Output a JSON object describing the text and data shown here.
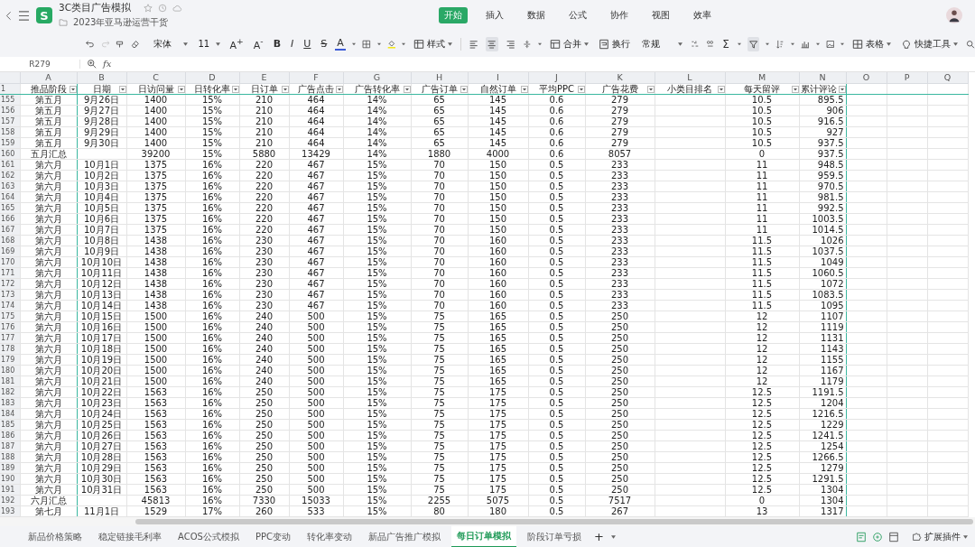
{
  "app": {
    "logo": "S",
    "title": "3C类目广告模拟",
    "location": "2023年亚马逊运营干货"
  },
  "menu_tabs": [
    {
      "label": "开始",
      "selected": true
    },
    {
      "label": "插入",
      "selected": false
    },
    {
      "label": "数据",
      "selected": false
    },
    {
      "label": "公式",
      "selected": false
    },
    {
      "label": "协作",
      "selected": false
    },
    {
      "label": "视图",
      "selected": false
    },
    {
      "label": "效率",
      "selected": false
    }
  ],
  "toolbar": {
    "redo_disabled": true,
    "font": "宋体",
    "font_size": "11",
    "grow_font": "A$^{+}$",
    "shrink_font": "A$^{-}$",
    "bold": "B",
    "italic": "I",
    "underline": "U",
    "strike": "S",
    "font_color": "A",
    "style": "样式",
    "align_buttons": [
      {
        "selected": false
      },
      {
        "selected": true
      },
      {
        "selected": false
      }
    ],
    "merge": "合并",
    "wrap": "换行",
    "number_format": "常规",
    "sum": "Σ",
    "filter_active": true,
    "table": "表格",
    "quick_tools": "快捷工具"
  },
  "formula_bar": {
    "cell": "R279",
    "fx": "fx"
  },
  "sheet": {
    "columns": [
      "A",
      "B",
      "C",
      "D",
      "E",
      "F",
      "G",
      "H",
      "I",
      "J",
      "K",
      "L",
      "M",
      "N",
      "O",
      "P",
      "Q"
    ],
    "header_row": "1",
    "headers": [
      "推品阶段",
      "日期",
      "日访问量",
      "日转化率",
      "日订单",
      "广告点击",
      "广告转化率",
      "广告订单",
      "自然订单",
      "平均PPC",
      "广告花费",
      "小类目排名",
      "每天留评",
      "累计评论"
    ],
    "rows": [
      {
        "n": "155",
        "cells": [
          "第五月",
          "9月26日",
          "1400",
          "15%",
          "210",
          "464",
          "14%",
          "65",
          "145",
          "0.6",
          "279",
          null,
          "10.5",
          "895.5"
        ]
      },
      {
        "n": "156",
        "cells": [
          "第五月",
          "9月27日",
          "1400",
          "15%",
          "210",
          "464",
          "14%",
          "65",
          "145",
          "0.6",
          "279",
          null,
          "10.5",
          "906"
        ]
      },
      {
        "n": "157",
        "cells": [
          "第五月",
          "9月28日",
          "1400",
          "15%",
          "210",
          "464",
          "14%",
          "65",
          "145",
          "0.6",
          "279",
          null,
          "10.5",
          "916.5"
        ]
      },
      {
        "n": "158",
        "cells": [
          "第五月",
          "9月29日",
          "1400",
          "15%",
          "210",
          "464",
          "14%",
          "65",
          "145",
          "0.6",
          "279",
          null,
          "10.5",
          "927"
        ]
      },
      {
        "n": "159",
        "cells": [
          "第五月",
          "9月30日",
          "1400",
          "15%",
          "210",
          "464",
          "14%",
          "65",
          "145",
          "0.6",
          "279",
          null,
          "10.5",
          "937.5"
        ]
      },
      {
        "n": "160",
        "cells": [
          "五月汇总",
          null,
          "39200",
          "15%",
          "5880",
          "13429",
          "14%",
          "1880",
          "4000",
          "0.6",
          "8057",
          null,
          "0",
          "937.5"
        ]
      },
      {
        "n": "161",
        "cells": [
          "第六月",
          "10月1日",
          "1375",
          "16%",
          "220",
          "467",
          "15%",
          "70",
          "150",
          "0.5",
          "233",
          null,
          "11",
          "948.5"
        ]
      },
      {
        "n": "162",
        "cells": [
          "第六月",
          "10月2日",
          "1375",
          "16%",
          "220",
          "467",
          "15%",
          "70",
          "150",
          "0.5",
          "233",
          null,
          "11",
          "959.5"
        ]
      },
      {
        "n": "163",
        "cells": [
          "第六月",
          "10月3日",
          "1375",
          "16%",
          "220",
          "467",
          "15%",
          "70",
          "150",
          "0.5",
          "233",
          null,
          "11",
          "970.5"
        ]
      },
      {
        "n": "164",
        "cells": [
          "第六月",
          "10月4日",
          "1375",
          "16%",
          "220",
          "467",
          "15%",
          "70",
          "150",
          "0.5",
          "233",
          null,
          "11",
          "981.5"
        ]
      },
      {
        "n": "165",
        "cells": [
          "第六月",
          "10月5日",
          "1375",
          "16%",
          "220",
          "467",
          "15%",
          "70",
          "150",
          "0.5",
          "233",
          null,
          "11",
          "992.5"
        ]
      },
      {
        "n": "166",
        "cells": [
          "第六月",
          "10月6日",
          "1375",
          "16%",
          "220",
          "467",
          "15%",
          "70",
          "150",
          "0.5",
          "233",
          null,
          "11",
          "1003.5"
        ]
      },
      {
        "n": "167",
        "cells": [
          "第六月",
          "10月7日",
          "1375",
          "16%",
          "220",
          "467",
          "15%",
          "70",
          "150",
          "0.5",
          "233",
          null,
          "11",
          "1014.5"
        ]
      },
      {
        "n": "168",
        "cells": [
          "第六月",
          "10月8日",
          "1438",
          "16%",
          "230",
          "467",
          "15%",
          "70",
          "160",
          "0.5",
          "233",
          null,
          "11.5",
          "1026"
        ]
      },
      {
        "n": "169",
        "cells": [
          "第六月",
          "10月9日",
          "1438",
          "16%",
          "230",
          "467",
          "15%",
          "70",
          "160",
          "0.5",
          "233",
          null,
          "11.5",
          "1037.5"
        ]
      },
      {
        "n": "170",
        "cells": [
          "第六月",
          "10月10日",
          "1438",
          "16%",
          "230",
          "467",
          "15%",
          "70",
          "160",
          "0.5",
          "233",
          null,
          "11.5",
          "1049"
        ]
      },
      {
        "n": "171",
        "cells": [
          "第六月",
          "10月11日",
          "1438",
          "16%",
          "230",
          "467",
          "15%",
          "70",
          "160",
          "0.5",
          "233",
          null,
          "11.5",
          "1060.5"
        ]
      },
      {
        "n": "172",
        "cells": [
          "第六月",
          "10月12日",
          "1438",
          "16%",
          "230",
          "467",
          "15%",
          "70",
          "160",
          "0.5",
          "233",
          null,
          "11.5",
          "1072"
        ]
      },
      {
        "n": "173",
        "cells": [
          "第六月",
          "10月13日",
          "1438",
          "16%",
          "230",
          "467",
          "15%",
          "70",
          "160",
          "0.5",
          "233",
          null,
          "11.5",
          "1083.5"
        ]
      },
      {
        "n": "174",
        "cells": [
          "第六月",
          "10月14日",
          "1438",
          "16%",
          "230",
          "467",
          "15%",
          "70",
          "160",
          "0.5",
          "233",
          null,
          "11.5",
          "1095"
        ]
      },
      {
        "n": "175",
        "cells": [
          "第六月",
          "10月15日",
          "1500",
          "16%",
          "240",
          "500",
          "15%",
          "75",
          "165",
          "0.5",
          "250",
          null,
          "12",
          "1107"
        ]
      },
      {
        "n": "176",
        "cells": [
          "第六月",
          "10月16日",
          "1500",
          "16%",
          "240",
          "500",
          "15%",
          "75",
          "165",
          "0.5",
          "250",
          null,
          "12",
          "1119"
        ]
      },
      {
        "n": "177",
        "cells": [
          "第六月",
          "10月17日",
          "1500",
          "16%",
          "240",
          "500",
          "15%",
          "75",
          "165",
          "0.5",
          "250",
          null,
          "12",
          "1131"
        ]
      },
      {
        "n": "178",
        "cells": [
          "第六月",
          "10月18日",
          "1500",
          "16%",
          "240",
          "500",
          "15%",
          "75",
          "165",
          "0.5",
          "250",
          null,
          "12",
          "1143"
        ]
      },
      {
        "n": "179",
        "cells": [
          "第六月",
          "10月19日",
          "1500",
          "16%",
          "240",
          "500",
          "15%",
          "75",
          "165",
          "0.5",
          "250",
          null,
          "12",
          "1155"
        ]
      },
      {
        "n": "180",
        "cells": [
          "第六月",
          "10月20日",
          "1500",
          "16%",
          "240",
          "500",
          "15%",
          "75",
          "165",
          "0.5",
          "250",
          null,
          "12",
          "1167"
        ]
      },
      {
        "n": "181",
        "cells": [
          "第六月",
          "10月21日",
          "1500",
          "16%",
          "240",
          "500",
          "15%",
          "75",
          "165",
          "0.5",
          "250",
          null,
          "12",
          "1179"
        ]
      },
      {
        "n": "182",
        "cells": [
          "第六月",
          "10月22日",
          "1563",
          "16%",
          "250",
          "500",
          "15%",
          "75",
          "175",
          "0.5",
          "250",
          null,
          "12.5",
          "1191.5"
        ]
      },
      {
        "n": "183",
        "cells": [
          "第六月",
          "10月23日",
          "1563",
          "16%",
          "250",
          "500",
          "15%",
          "75",
          "175",
          "0.5",
          "250",
          null,
          "12.5",
          "1204"
        ]
      },
      {
        "n": "184",
        "cells": [
          "第六月",
          "10月24日",
          "1563",
          "16%",
          "250",
          "500",
          "15%",
          "75",
          "175",
          "0.5",
          "250",
          null,
          "12.5",
          "1216.5"
        ]
      },
      {
        "n": "185",
        "cells": [
          "第六月",
          "10月25日",
          "1563",
          "16%",
          "250",
          "500",
          "15%",
          "75",
          "175",
          "0.5",
          "250",
          null,
          "12.5",
          "1229"
        ]
      },
      {
        "n": "186",
        "cells": [
          "第六月",
          "10月26日",
          "1563",
          "16%",
          "250",
          "500",
          "15%",
          "75",
          "175",
          "0.5",
          "250",
          null,
          "12.5",
          "1241.5"
        ]
      },
      {
        "n": "187",
        "cells": [
          "第六月",
          "10月27日",
          "1563",
          "16%",
          "250",
          "500",
          "15%",
          "75",
          "175",
          "0.5",
          "250",
          null,
          "12.5",
          "1254"
        ]
      },
      {
        "n": "188",
        "cells": [
          "第六月",
          "10月28日",
          "1563",
          "16%",
          "250",
          "500",
          "15%",
          "75",
          "175",
          "0.5",
          "250",
          null,
          "12.5",
          "1266.5"
        ]
      },
      {
        "n": "189",
        "cells": [
          "第六月",
          "10月29日",
          "1563",
          "16%",
          "250",
          "500",
          "15%",
          "75",
          "175",
          "0.5",
          "250",
          null,
          "12.5",
          "1279"
        ]
      },
      {
        "n": "190",
        "cells": [
          "第六月",
          "10月30日",
          "1563",
          "16%",
          "250",
          "500",
          "15%",
          "75",
          "175",
          "0.5",
          "250",
          null,
          "12.5",
          "1291.5"
        ]
      },
      {
        "n": "191",
        "cells": [
          "第六月",
          "10月31日",
          "1563",
          "16%",
          "250",
          "500",
          "15%",
          "75",
          "175",
          "0.5",
          "250",
          null,
          "12.5",
          "1304"
        ]
      },
      {
        "n": "192",
        "cells": [
          "六月汇总",
          null,
          "45813",
          "16%",
          "7330",
          "15033",
          "15%",
          "2255",
          "5075",
          "0.5",
          "7517",
          null,
          "0",
          "1304"
        ]
      },
      {
        "n": "193",
        "cells": [
          "第七月",
          "11月1日",
          "1529",
          "17%",
          "260",
          "533",
          "15%",
          "80",
          "180",
          "0.5",
          "267",
          null,
          "13",
          "1317"
        ]
      }
    ]
  },
  "sheet_tabs": [
    {
      "label": "新品价格策略",
      "selected": false
    },
    {
      "label": "稳定链接毛利率",
      "selected": false
    },
    {
      "label": "ACOS公式模拟",
      "selected": false
    },
    {
      "label": "PPC变动",
      "selected": false
    },
    {
      "label": "转化率变动",
      "selected": false
    },
    {
      "label": "新品广告推广模拟",
      "selected": false
    },
    {
      "label": "每日订单模拟",
      "selected": true
    },
    {
      "label": "阶段订单亏损",
      "selected": false
    }
  ],
  "add_sheet": "+",
  "extensions": "扩展插件"
}
